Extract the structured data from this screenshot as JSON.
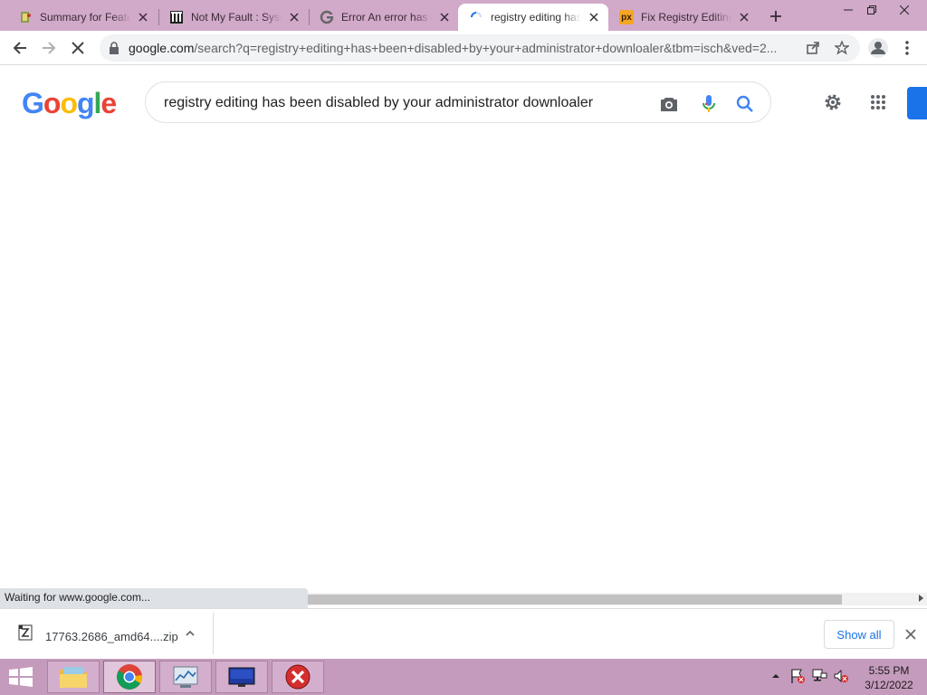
{
  "tabs": [
    {
      "title": "Summary for Feature",
      "favicon": "puzzle-icon"
    },
    {
      "title": "Not My Fault : Sysinternals",
      "favicon": "archive-icon"
    },
    {
      "title": "Error An error has occurred",
      "favicon": "google-icon"
    },
    {
      "title": "registry editing has been disabled",
      "favicon": "loading-spinner-icon"
    },
    {
      "title": "Fix Registry Editing",
      "favicon": "px-icon",
      "favicon_text": "px"
    }
  ],
  "address": {
    "host": "google.com",
    "path": "/search?q=registry+editing+has+been+disabled+by+your+administrator+downloaler&tbm=isch&ved=2..."
  },
  "google": {
    "logo_letters": [
      "G",
      "o",
      "o",
      "g",
      "l",
      "e"
    ],
    "logo_colors": [
      "#4285f4",
      "#ea4335",
      "#fbbc05",
      "#4285f4",
      "#34a853",
      "#ea4335"
    ],
    "query": "registry editing has been disabled by your administrator downloaler"
  },
  "status": "Waiting for www.google.com...",
  "download": {
    "filename": "17763.2686_amd64....zip",
    "show_all": "Show all"
  },
  "clock": {
    "time": "5:55 PM",
    "date": "3/12/2022"
  },
  "colors": {
    "tabstrip": "#d1a9c9",
    "taskbar": "#c59bbd",
    "accent": "#1a73e8"
  }
}
